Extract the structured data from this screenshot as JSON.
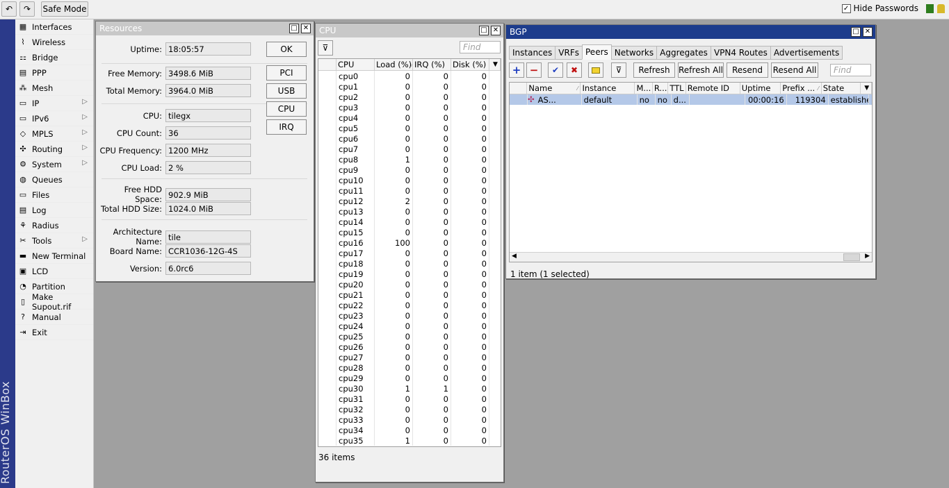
{
  "toolbar": {
    "undo_icon": "undo-icon",
    "redo_icon": "redo-icon",
    "safe_mode": "Safe Mode",
    "hide_passwords": "Hide Passwords",
    "hide_passwords_checked": true
  },
  "brand": "RouterOS WinBox",
  "sidebar": {
    "items": [
      {
        "label": "Interfaces",
        "icon": "interfaces-icon",
        "submenu": false
      },
      {
        "label": "Wireless",
        "icon": "wireless-icon",
        "submenu": false
      },
      {
        "label": "Bridge",
        "icon": "bridge-icon",
        "submenu": false
      },
      {
        "label": "PPP",
        "icon": "ppp-icon",
        "submenu": false
      },
      {
        "label": "Mesh",
        "icon": "mesh-icon",
        "submenu": false
      },
      {
        "label": "IP",
        "icon": "ip-icon",
        "submenu": true
      },
      {
        "label": "IPv6",
        "icon": "ipv6-icon",
        "submenu": true
      },
      {
        "label": "MPLS",
        "icon": "mpls-icon",
        "submenu": true
      },
      {
        "label": "Routing",
        "icon": "routing-icon",
        "submenu": true
      },
      {
        "label": "System",
        "icon": "system-icon",
        "submenu": true
      },
      {
        "label": "Queues",
        "icon": "queues-icon",
        "submenu": false
      },
      {
        "label": "Files",
        "icon": "files-icon",
        "submenu": false
      },
      {
        "label": "Log",
        "icon": "log-icon",
        "submenu": false
      },
      {
        "label": "Radius",
        "icon": "radius-icon",
        "submenu": false
      },
      {
        "label": "Tools",
        "icon": "tools-icon",
        "submenu": true
      },
      {
        "label": "New Terminal",
        "icon": "terminal-icon",
        "submenu": false
      },
      {
        "label": "LCD",
        "icon": "lcd-icon",
        "submenu": false
      },
      {
        "label": "Partition",
        "icon": "partition-icon",
        "submenu": false
      },
      {
        "label": "Make Supout.rif",
        "icon": "supout-icon",
        "submenu": false
      },
      {
        "label": "Manual",
        "icon": "manual-icon",
        "submenu": false
      },
      {
        "label": "Exit",
        "icon": "exit-icon",
        "submenu": false
      }
    ]
  },
  "resources": {
    "title": "Resources",
    "fields": [
      {
        "label": "Uptime:",
        "value": "18:05:57"
      },
      {
        "label": "Free Memory:",
        "value": "3498.6 MiB"
      },
      {
        "label": "Total Memory:",
        "value": "3964.0 MiB"
      },
      {
        "label": "CPU:",
        "value": "tilegx"
      },
      {
        "label": "CPU Count:",
        "value": "36"
      },
      {
        "label": "CPU Frequency:",
        "value": "1200 MHz"
      },
      {
        "label": "CPU Load:",
        "value": "2 %"
      },
      {
        "label": "Free HDD Space:",
        "value": "902.9 MiB"
      },
      {
        "label": "Total HDD Size:",
        "value": "1024.0 MiB"
      },
      {
        "label": "Architecture Name:",
        "value": "tile"
      },
      {
        "label": "Board Name:",
        "value": "CCR1036-12G-4S"
      },
      {
        "label": "Version:",
        "value": "6.0rc6"
      }
    ],
    "buttons": [
      "OK",
      "PCI",
      "USB",
      "CPU",
      "IRQ"
    ]
  },
  "cpu": {
    "title": "CPU",
    "find_placeholder": "Find",
    "columns": [
      "CPU",
      "Load (%)",
      "IRQ (%)",
      "Disk (%)"
    ],
    "rows": [
      [
        "cpu0",
        "0",
        "0",
        "0"
      ],
      [
        "cpu1",
        "0",
        "0",
        "0"
      ],
      [
        "cpu2",
        "0",
        "0",
        "0"
      ],
      [
        "cpu3",
        "0",
        "0",
        "0"
      ],
      [
        "cpu4",
        "0",
        "0",
        "0"
      ],
      [
        "cpu5",
        "0",
        "0",
        "0"
      ],
      [
        "cpu6",
        "0",
        "0",
        "0"
      ],
      [
        "cpu7",
        "0",
        "0",
        "0"
      ],
      [
        "cpu8",
        "1",
        "0",
        "0"
      ],
      [
        "cpu9",
        "0",
        "0",
        "0"
      ],
      [
        "cpu10",
        "0",
        "0",
        "0"
      ],
      [
        "cpu11",
        "0",
        "0",
        "0"
      ],
      [
        "cpu12",
        "2",
        "0",
        "0"
      ],
      [
        "cpu13",
        "0",
        "0",
        "0"
      ],
      [
        "cpu14",
        "0",
        "0",
        "0"
      ],
      [
        "cpu15",
        "0",
        "0",
        "0"
      ],
      [
        "cpu16",
        "100",
        "0",
        "0"
      ],
      [
        "cpu17",
        "0",
        "0",
        "0"
      ],
      [
        "cpu18",
        "0",
        "0",
        "0"
      ],
      [
        "cpu19",
        "0",
        "0",
        "0"
      ],
      [
        "cpu20",
        "0",
        "0",
        "0"
      ],
      [
        "cpu21",
        "0",
        "0",
        "0"
      ],
      [
        "cpu22",
        "0",
        "0",
        "0"
      ],
      [
        "cpu23",
        "0",
        "0",
        "0"
      ],
      [
        "cpu24",
        "0",
        "0",
        "0"
      ],
      [
        "cpu25",
        "0",
        "0",
        "0"
      ],
      [
        "cpu26",
        "0",
        "0",
        "0"
      ],
      [
        "cpu27",
        "0",
        "0",
        "0"
      ],
      [
        "cpu28",
        "0",
        "0",
        "0"
      ],
      [
        "cpu29",
        "0",
        "0",
        "0"
      ],
      [
        "cpu30",
        "1",
        "1",
        "0"
      ],
      [
        "cpu31",
        "0",
        "0",
        "0"
      ],
      [
        "cpu32",
        "0",
        "0",
        "0"
      ],
      [
        "cpu33",
        "0",
        "0",
        "0"
      ],
      [
        "cpu34",
        "0",
        "0",
        "0"
      ],
      [
        "cpu35",
        "1",
        "0",
        "0"
      ]
    ],
    "status": "36 items"
  },
  "bgp": {
    "title": "BGP",
    "tabs": [
      "Instances",
      "VRFs",
      "Peers",
      "Networks",
      "Aggregates",
      "VPN4 Routes",
      "Advertisements"
    ],
    "selected_tab": "Peers",
    "toolbar_buttons": [
      "Refresh",
      "Refresh All",
      "Resend",
      "Resend All"
    ],
    "find_placeholder": "Find",
    "columns": [
      "Name",
      "Instance",
      "M...",
      "R...",
      "TTL",
      "Remote ID",
      "Uptime",
      "Prefix ...",
      "State"
    ],
    "rows": [
      [
        "AS...",
        "default",
        "no",
        "no",
        "d...",
        "",
        "00:00:16",
        "119304",
        "established"
      ]
    ],
    "status": "1 item (1 selected)"
  }
}
